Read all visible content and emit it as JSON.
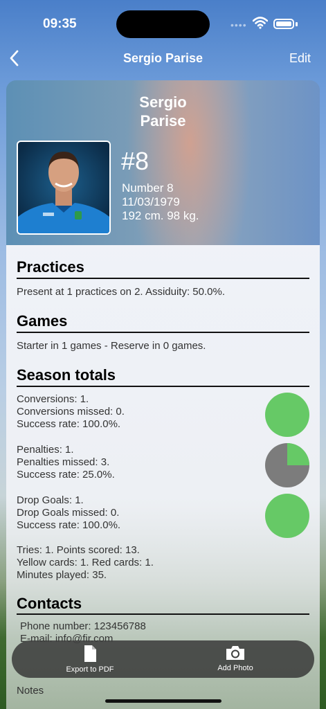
{
  "status": {
    "time": "09:35"
  },
  "nav": {
    "title": "Sergio Parise",
    "edit_label": "Edit"
  },
  "player": {
    "name": "Sergio\nParise",
    "number_large": "#8",
    "number_text": "Number 8",
    "birthdate": "11/03/1979",
    "measures": "192 cm. 98 kg."
  },
  "practices": {
    "title": "Practices",
    "summary": "Present at 1 practices on 2. Assiduity: 50.0%."
  },
  "games": {
    "title": "Games",
    "summary": "Starter in 1 games - Reserve in 0 games."
  },
  "season": {
    "title": "Season totals",
    "conversions": {
      "line1": "Conversions: 1.",
      "line2": "Conversions missed: 0.",
      "line3": "Success rate: 100.0%.",
      "rate": 1.0
    },
    "penalties": {
      "line1": "Penalties: 1.",
      "line2": "Penalties missed: 3.",
      "line3": "Success rate: 25.0%.",
      "rate": 0.25
    },
    "drop_goals": {
      "line1": "Drop Goals: 1.",
      "line2": "Drop Goals missed: 0.",
      "line3": "Success rate: 100.0%.",
      "rate": 1.0
    },
    "other": {
      "line1": "Tries: 1. Points scored: 13.",
      "line2": "Yellow cards: 1. Red cards: 1.",
      "line3": "Minutes played: 35."
    },
    "colors": {
      "success": "#66c966",
      "miss": "#7c7c7c"
    }
  },
  "contacts": {
    "title": "Contacts",
    "phone": "Phone number: 123456788",
    "email": "E-mail: info@fir.com"
  },
  "toolbar": {
    "export_label": "Export to PDF",
    "photo_label": "Add Photo"
  },
  "notes_label": "Notes"
}
